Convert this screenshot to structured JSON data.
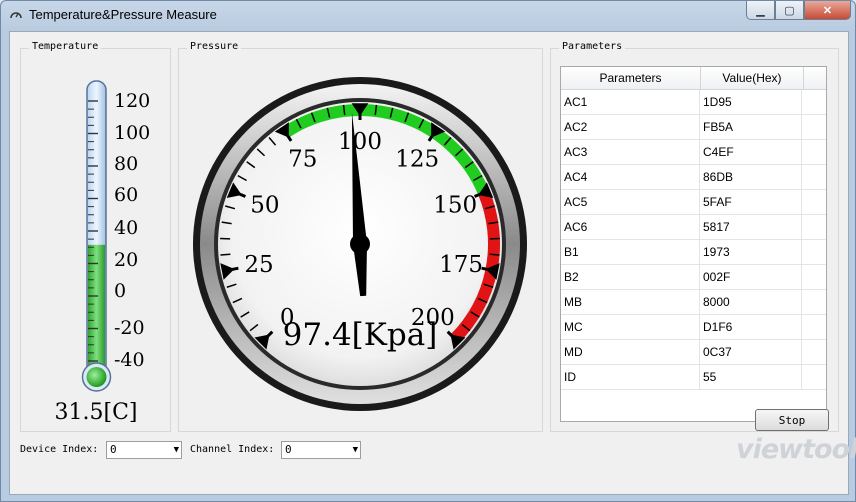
{
  "window": {
    "title": "Temperature&Pressure Measure"
  },
  "temperature": {
    "group_title": "Temperature",
    "scale": [
      "120",
      "100",
      "80",
      "60",
      "40",
      "20",
      "0",
      "-20",
      "-40"
    ],
    "reading": "31.5[C]",
    "value": 31.5,
    "fill_color": "#3cbe3c"
  },
  "pressure": {
    "group_title": "Pressure",
    "scale": [
      "0",
      "25",
      "50",
      "75",
      "100",
      "125",
      "150",
      "175",
      "200"
    ],
    "reading": "97.4[Kpa]",
    "value": 97.4,
    "green_color": "#1fcc1f",
    "red_color": "#e01414"
  },
  "parameters": {
    "group_title": "Parameters",
    "headers": [
      "Parameters",
      "Value(Hex)"
    ],
    "rows": [
      [
        "AC1",
        "1D95"
      ],
      [
        "AC2",
        "FB5A"
      ],
      [
        "AC3",
        "C4EF"
      ],
      [
        "AC4",
        "86DB"
      ],
      [
        "AC5",
        "5FAF"
      ],
      [
        "AC6",
        "5817"
      ],
      [
        "B1",
        "1973"
      ],
      [
        "B2",
        "002F"
      ],
      [
        "MB",
        "8000"
      ],
      [
        "MC",
        "D1F6"
      ],
      [
        "MD",
        "0C37"
      ],
      [
        "ID",
        "55"
      ]
    ]
  },
  "controls": {
    "device_label": "Device Index:",
    "device_value": "0",
    "channel_label": "Channel Index:",
    "channel_value": "0",
    "stop_label": "Stop"
  },
  "watermark": "viewtool"
}
